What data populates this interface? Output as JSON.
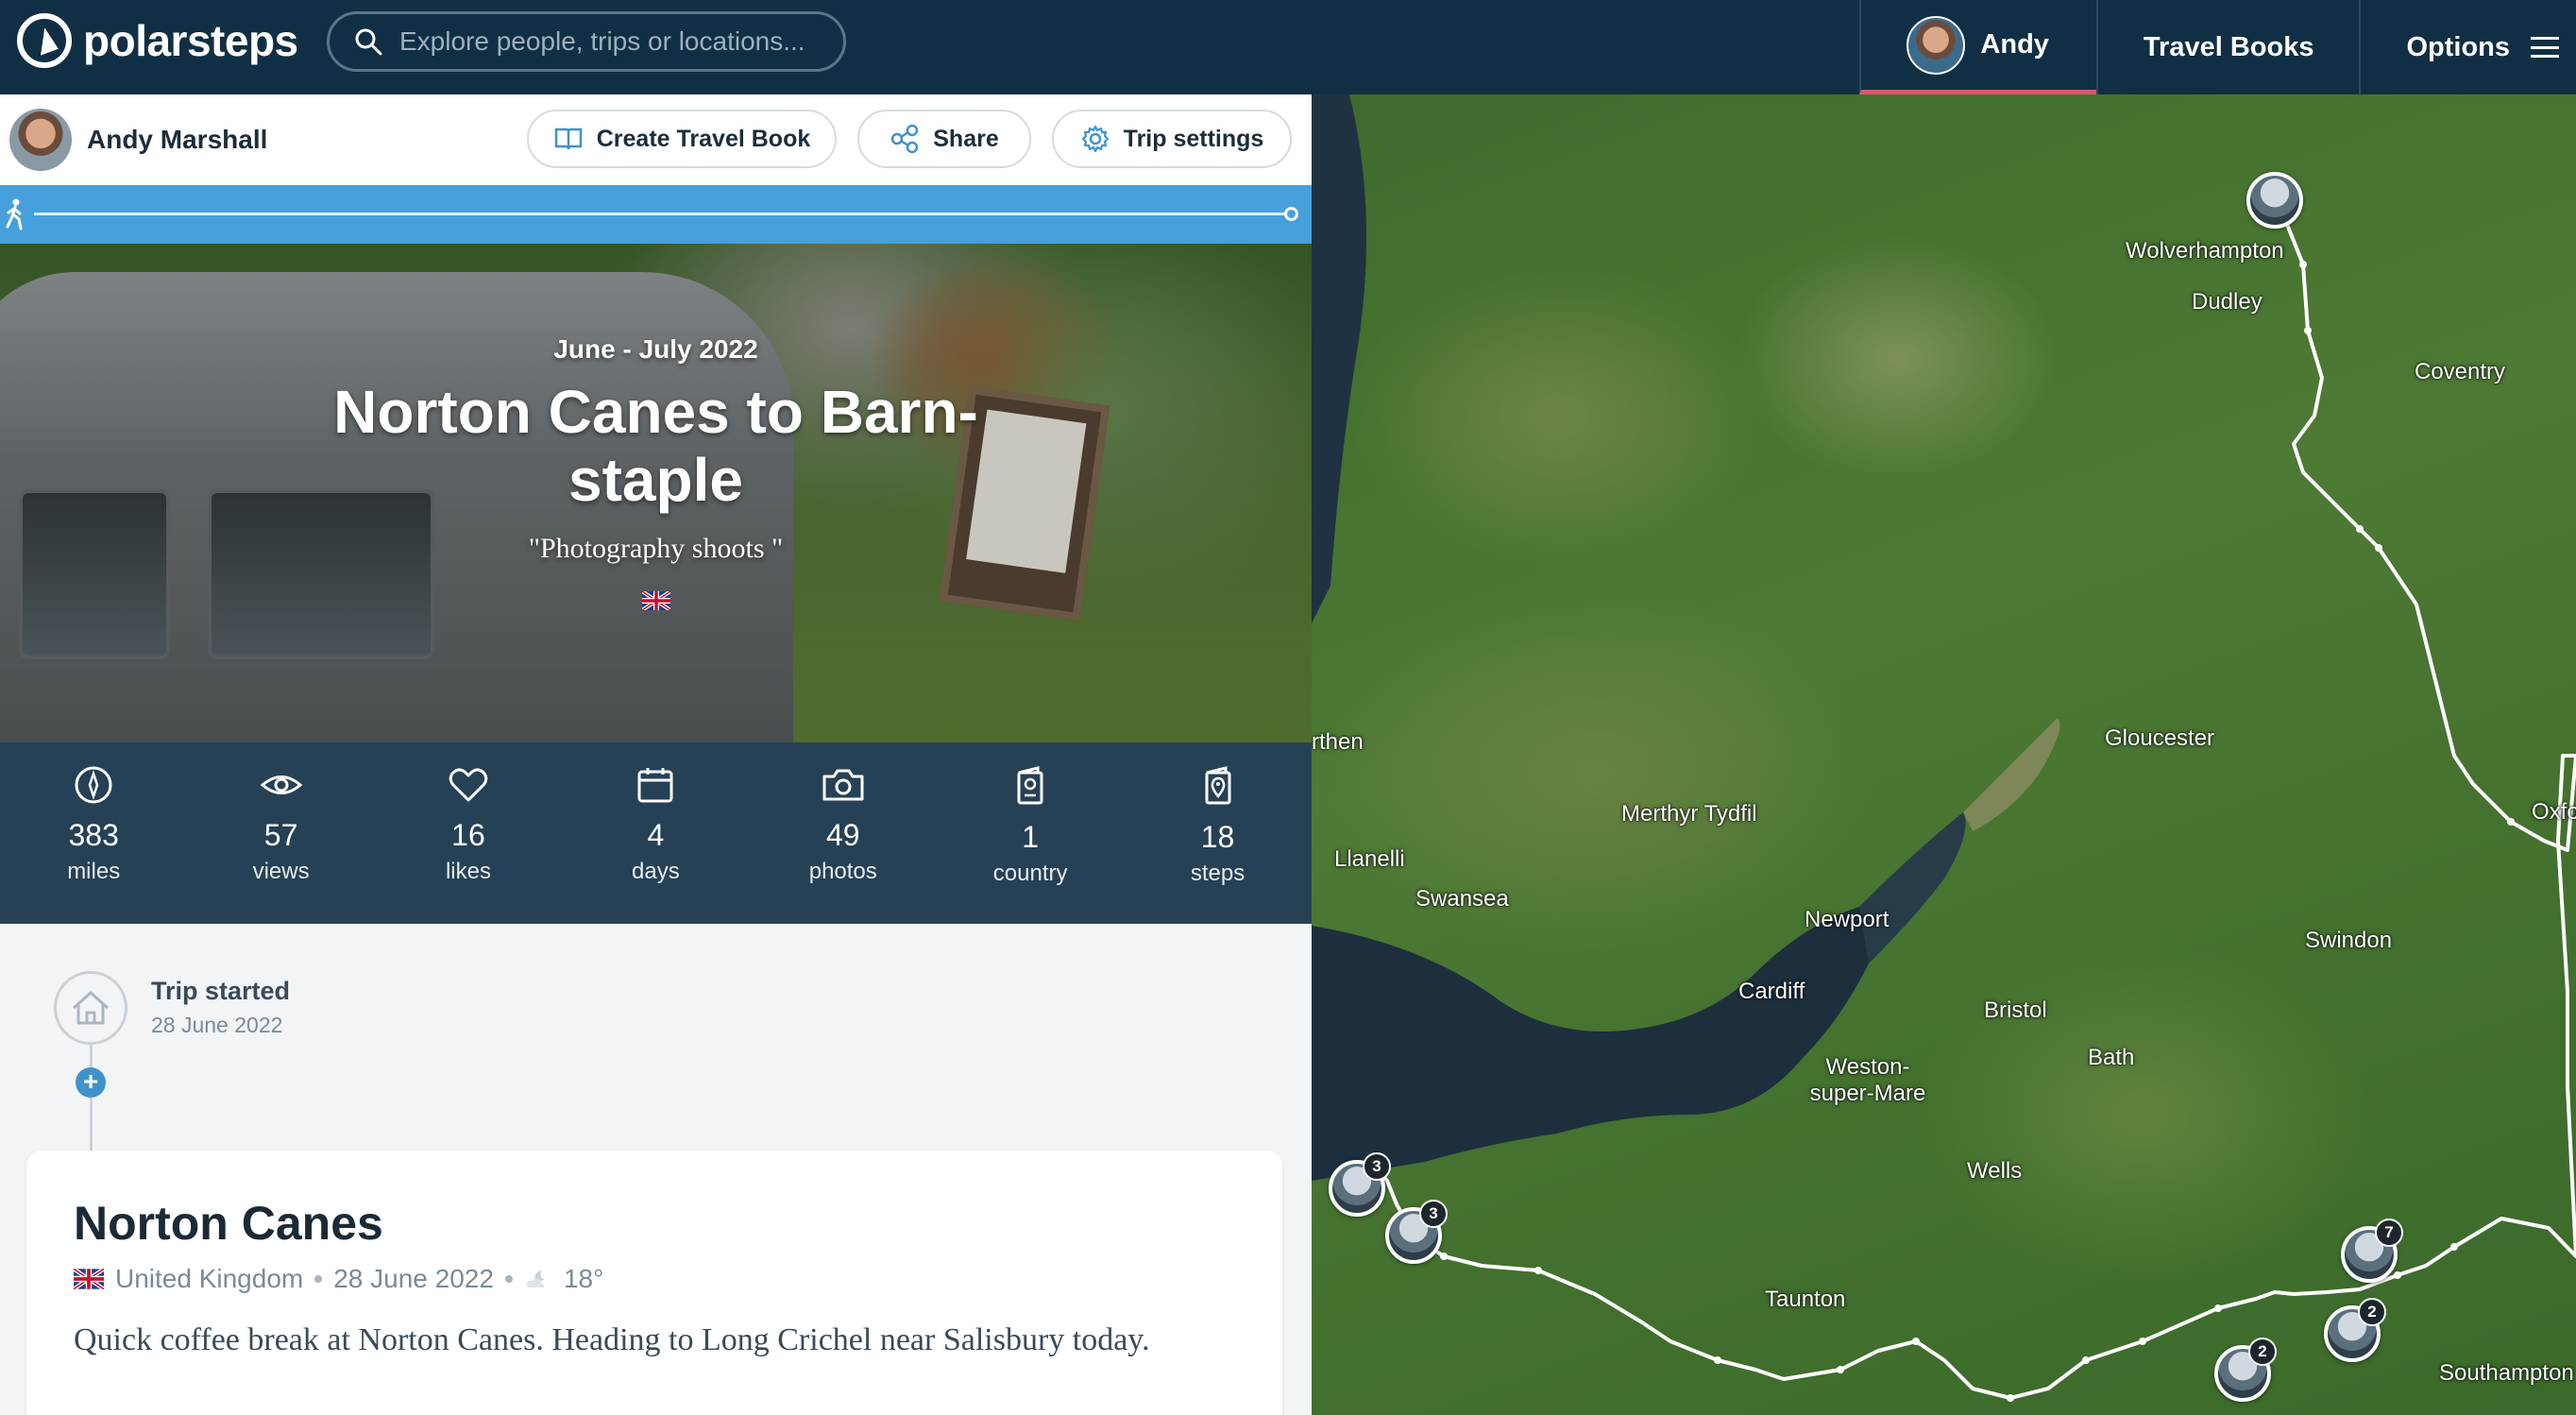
{
  "nav": {
    "logo_text": "polarsteps",
    "search_placeholder": "Explore people, trips or locations...",
    "user_label": "Andy",
    "travel_books_label": "Travel Books",
    "options_label": "Options"
  },
  "trip_header": {
    "owner_name": "Andy Marshall",
    "create_book_label": "Create Travel Book",
    "share_label": "Share",
    "settings_label": "Trip settings"
  },
  "hero": {
    "dates": "June - July 2022",
    "title": "Norton Canes to Barn-staple",
    "subtitle": "\"Photography shoots \"",
    "trip_progress": 1.0
  },
  "stats": [
    {
      "icon": "compass-icon",
      "value": "383",
      "label": "miles"
    },
    {
      "icon": "eye-icon",
      "value": "57",
      "label": "views"
    },
    {
      "icon": "heart-icon",
      "value": "16",
      "label": "likes"
    },
    {
      "icon": "calendar-icon",
      "value": "4",
      "label": "days"
    },
    {
      "icon": "camera-icon",
      "value": "49",
      "label": "photos"
    },
    {
      "icon": "passport-icon",
      "value": "1",
      "label": "country"
    },
    {
      "icon": "location-pin-icon",
      "value": "18",
      "label": "steps"
    }
  ],
  "timeline": {
    "start_title": "Trip started",
    "start_date": "28 June 2022"
  },
  "step": {
    "title": "Norton Canes",
    "country": "United Kingdom",
    "date": "28 June 2022",
    "temperature": "18°",
    "description": "Quick coffee break at Norton Canes. Heading to Long Crichel near Salisbury today."
  },
  "map": {
    "cities": [
      "Wolverhampton",
      "Dudley",
      "Coventry",
      "rthen",
      "Gloucester",
      "Merthyr Tydfil",
      "Oxfo",
      "Llanelli",
      "Swansea",
      "Newport",
      "Swindon",
      "Cardiff",
      "Bristol",
      "Bath",
      "Weston-super-Mare",
      "Wells",
      "Taunton",
      "Southampton"
    ],
    "pin_counts": [
      "3",
      "3",
      "7",
      "2",
      "2"
    ]
  },
  "colors": {
    "nav_bg": "#102f44",
    "accent_blue": "#46a0dc",
    "active_underline": "#e0556a"
  }
}
